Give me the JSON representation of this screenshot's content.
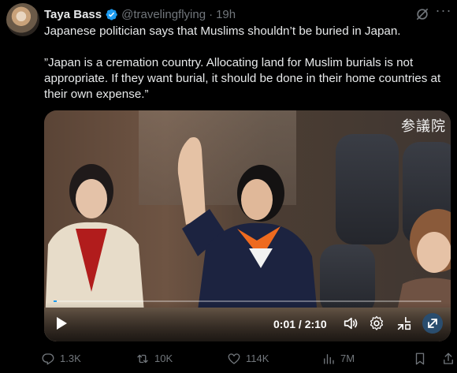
{
  "author": {
    "name": "Taya Bass",
    "handle": "@travelingflying",
    "separator": "·",
    "time": "19h"
  },
  "post": {
    "line1": "Japanese politician says that Muslims shouldn’t be buried in Japan.",
    "line2": "”Japan is a cremation country. Allocating land for Muslim burials is not appropriate. If they want burial, it should be done in their home countries at their own expense.”"
  },
  "video": {
    "watermark": "参議院",
    "timecode": "0:01 / 2:10",
    "progress": 0.008
  },
  "actions": {
    "replies": "1.3K",
    "reposts": "10K",
    "likes": "114K",
    "views": "7M"
  },
  "colors": {
    "background": "#000000",
    "text": "#e7e9ea",
    "muted": "#71767b",
    "verified": "#1d9bf0"
  },
  "icons": [
    "verified-badge-icon",
    "grok-icon",
    "more-icon",
    "play-icon",
    "volume-icon",
    "settings-icon",
    "fullscreen-exit-icon",
    "expand-icon",
    "reply-icon",
    "repost-icon",
    "like-icon",
    "views-icon",
    "bookmark-icon"
  ]
}
